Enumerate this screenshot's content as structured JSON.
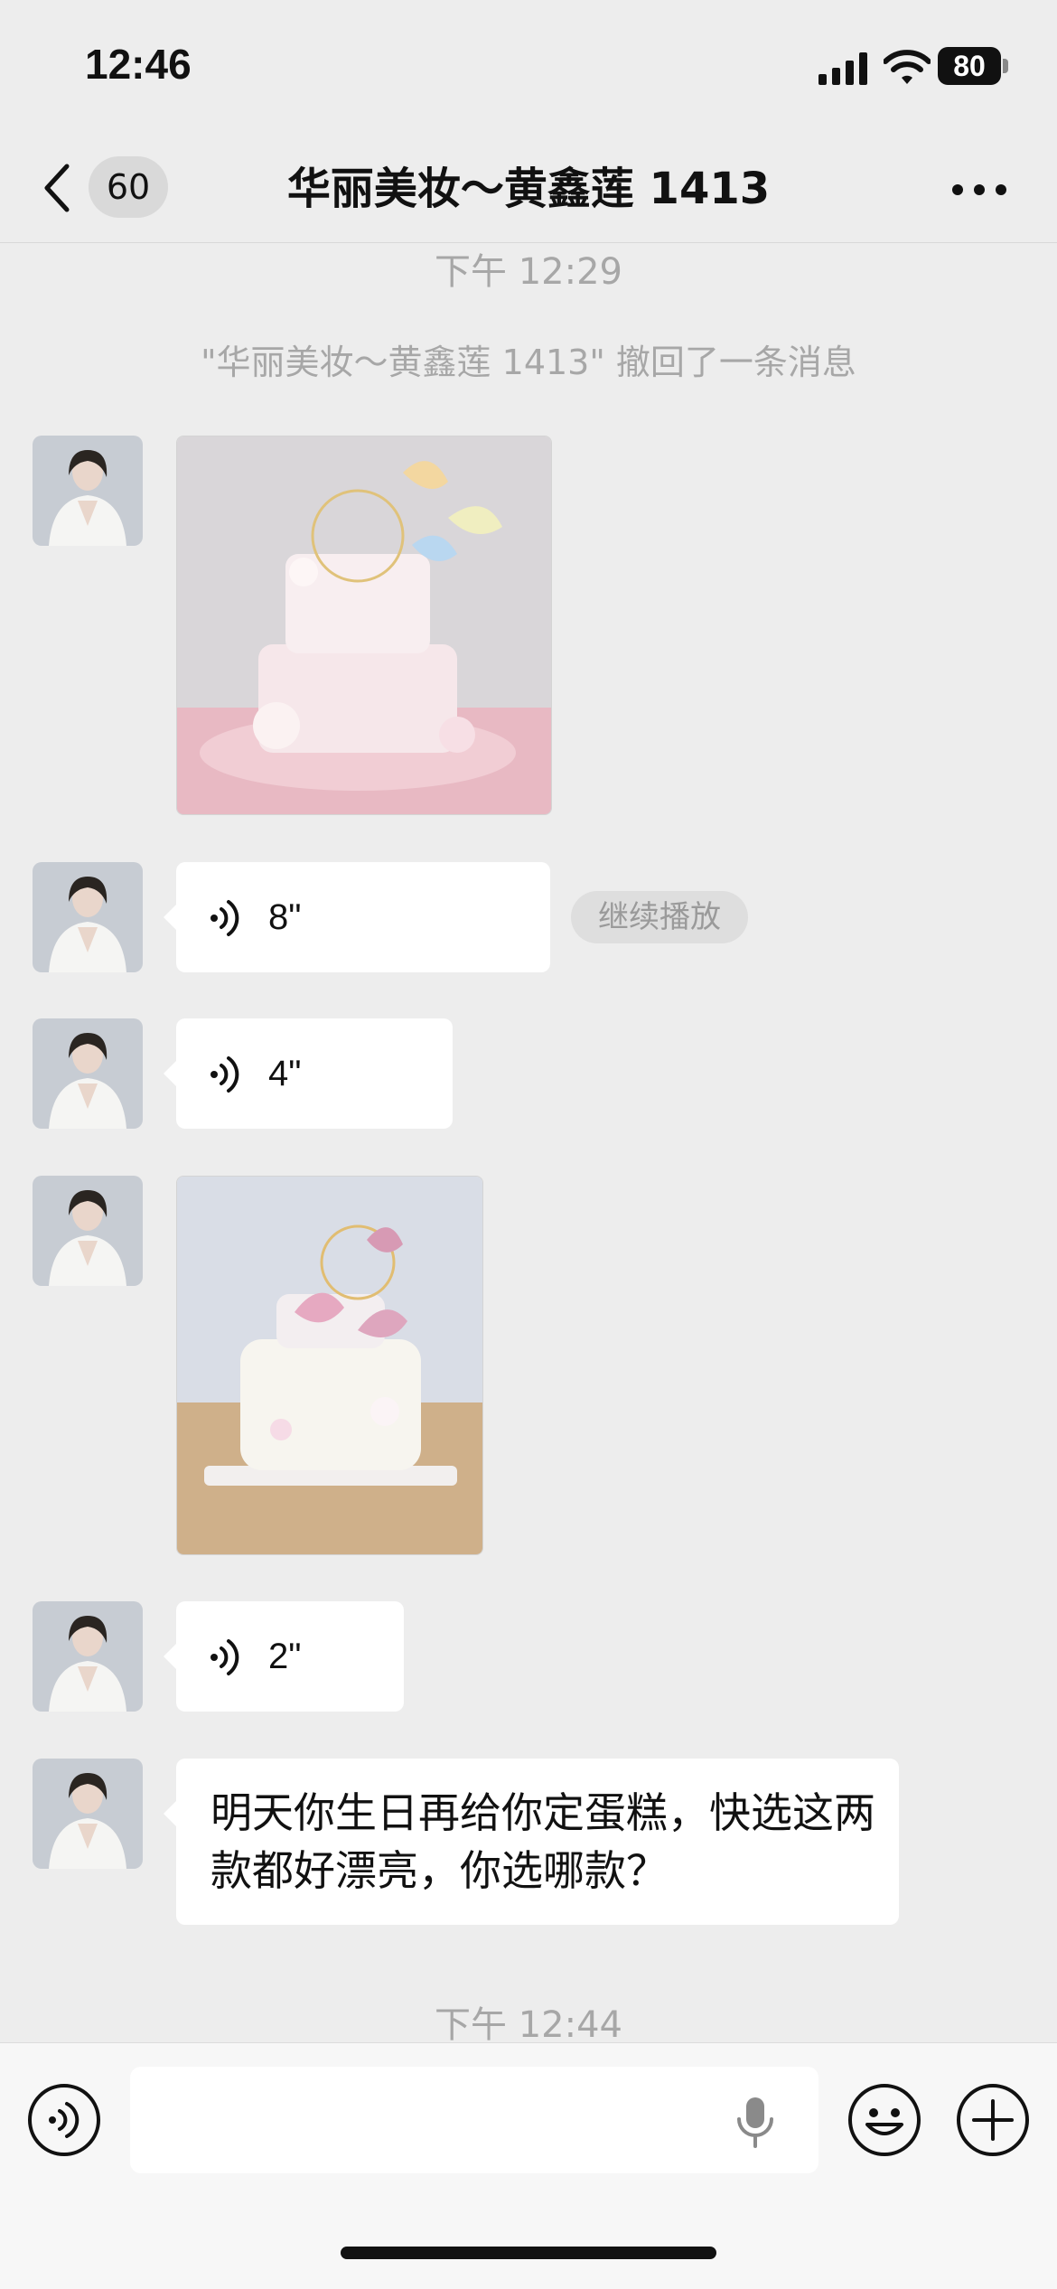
{
  "status_bar": {
    "time": "12:46",
    "battery": "80",
    "icons": [
      "signal-icon",
      "wifi-icon",
      "battery-icon"
    ]
  },
  "header": {
    "back_icon": "chevron-left-icon",
    "unread_count": "60",
    "title": "华丽美妆～黄鑫莲 1413",
    "more_icon": "ellipsis-icon"
  },
  "messages": {
    "timestamp_1": "下午 12:29",
    "recall_notice": "\"华丽美妆～黄鑫莲 1413\" 撤回了一条消息",
    "voice_1": {
      "duration": "8\"",
      "action": "继续播放"
    },
    "voice_2": {
      "duration": "4\""
    },
    "voice_3": {
      "duration": "2\""
    },
    "text_1": "明天你生日再给你定蛋糕，快选这两款都好漂亮，你选哪款？",
    "timestamp_2": "下午 12:44"
  },
  "input_bar": {
    "voice_icon": "voice-mode-icon",
    "mic_icon": "microphone-icon",
    "emoji_icon": "emoji-icon",
    "plus_icon": "plus-icon"
  },
  "colors": {
    "background": "#ededed",
    "bubble": "#ffffff",
    "muted_text": "#a7a7a7"
  }
}
